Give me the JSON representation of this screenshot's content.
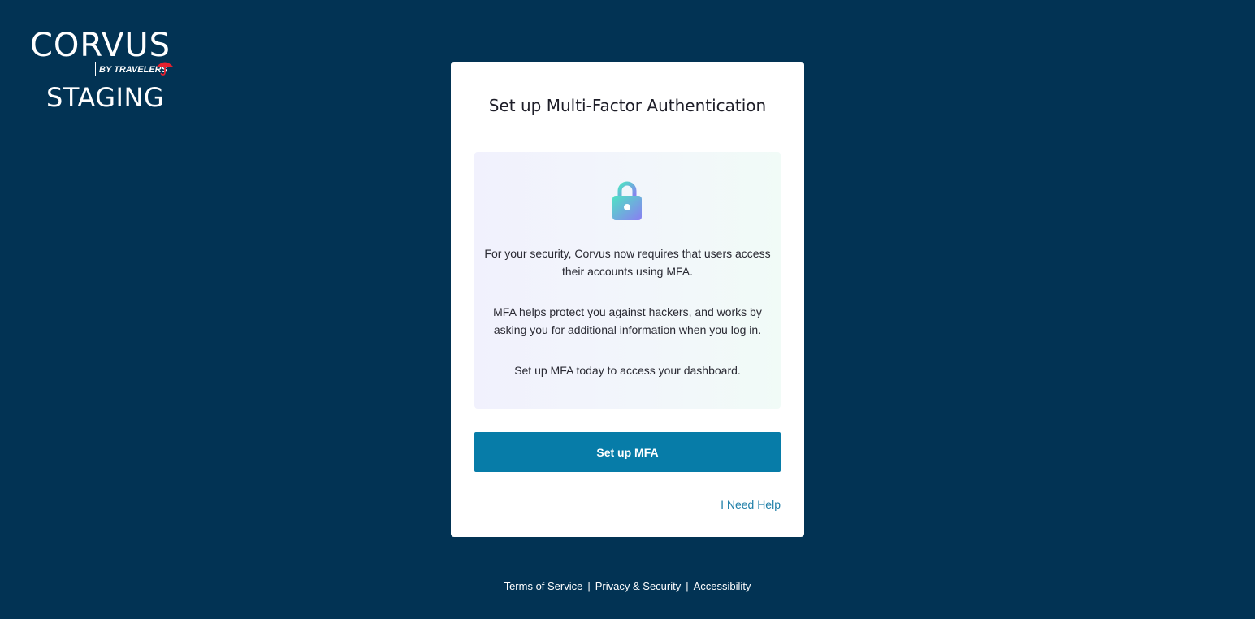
{
  "brand": {
    "wordmark": "CORVUS",
    "byline": "BY TRAVELERS",
    "environment": "STAGING",
    "umbrella_color": "#e4202e"
  },
  "card": {
    "title": "Set up Multi-Factor Authentication",
    "icon": "lock-icon",
    "paragraphs": [
      "For your security, Corvus now requires that users access their accounts using MFA.",
      "MFA helps protect you against hackers, and works by asking you for additional information when you log in.",
      "Set up MFA today to access your dashboard."
    ],
    "primary_button_label": "Set up MFA",
    "help_link_label": "I Need Help"
  },
  "footer": {
    "links": [
      "Terms of Service",
      "Privacy & Security",
      "Accessibility"
    ],
    "separator": "|"
  },
  "colors": {
    "background": "#023354",
    "button": "#077ca8",
    "link": "#1f7fa8"
  }
}
